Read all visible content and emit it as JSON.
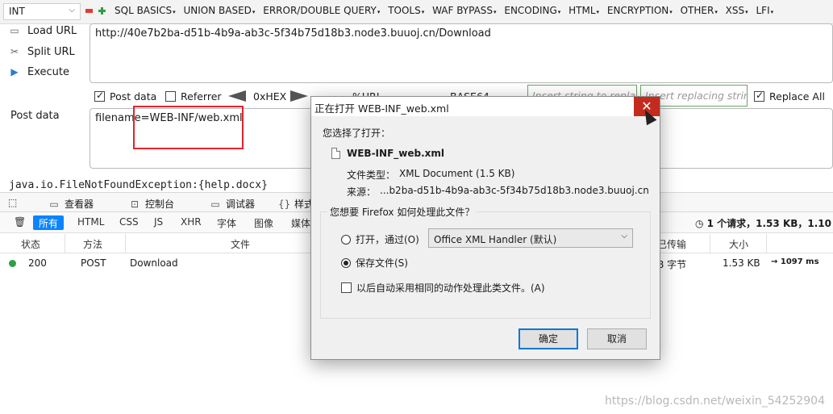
{
  "toolbar": {
    "int_value": "INT",
    "menus": [
      "SQL BASICS",
      "UNION BASED",
      "ERROR/DOUBLE QUERY",
      "TOOLS",
      "WAF BYPASS",
      "ENCODING",
      "HTML",
      "ENCRYPTION",
      "OTHER",
      "XSS",
      "LFI"
    ],
    "colors": {
      "red_dot": "#e03c31",
      "green_dot": "#2ea043"
    }
  },
  "sidebar": {
    "load_url": "Load URL",
    "split_url": "Split URL",
    "execute": "Execute"
  },
  "url_field": {
    "value": "http://40e7b2ba-d51b-4b9a-ab3c-5f34b75d18b3.node3.buuoj.cn/Download"
  },
  "options": {
    "post_data": "Post data",
    "referrer": "Referrer",
    "hex": "0xHEX",
    "url": "%URL",
    "base64": "BASE64",
    "replace_find_placeholder": "Insert string to replace",
    "replace_with_placeholder": "Insert replacing string",
    "replace_all": "Replace All"
  },
  "post": {
    "label": "Post data",
    "value": "filename=WEB-INF/web.xml"
  },
  "console": {
    "line": "java.io.FileNotFoundException:{help.docx}"
  },
  "devtools": {
    "tabs": [
      "查看器",
      "控制台",
      "调试器",
      "样式"
    ],
    "filters": [
      "所有",
      "HTML",
      "CSS",
      "JS",
      "XHR",
      "字体",
      "图像",
      "媒体"
    ],
    "summary": "1 个请求，1.53 KB，1.10",
    "headers": {
      "status": "状态",
      "method": "方法",
      "file": "文件",
      "transferred": "已传输",
      "size": "大小"
    },
    "row": {
      "status": "200",
      "method": "POST",
      "file": "Download",
      "transferred": "98 字节",
      "size": "1.53 KB",
      "time": "→ 1097 ms"
    }
  },
  "dialog": {
    "title": "正在打开 WEB-INF_web.xml",
    "intro": "您选择了打开：",
    "filename": "WEB-INF_web.xml",
    "type_label": "文件类型：",
    "type_value": "XML Document (1.5 KB)",
    "source_label": "来源：",
    "source_value": "...b2ba-d51b-4b9a-ab3c-5f34b75d18b3.node3.buuoj.cn",
    "question": "您想要 Firefox 如何处理此文件？",
    "open_with": "打开，通过(O)",
    "app": "Office XML Handler (默认)",
    "save_file": "保存文件(S)",
    "auto": "以后自动采用相同的动作处理此类文件。(A)",
    "ok": "确定",
    "cancel": "取消"
  },
  "watermark": "https://blog.csdn.net/weixin_54252904"
}
